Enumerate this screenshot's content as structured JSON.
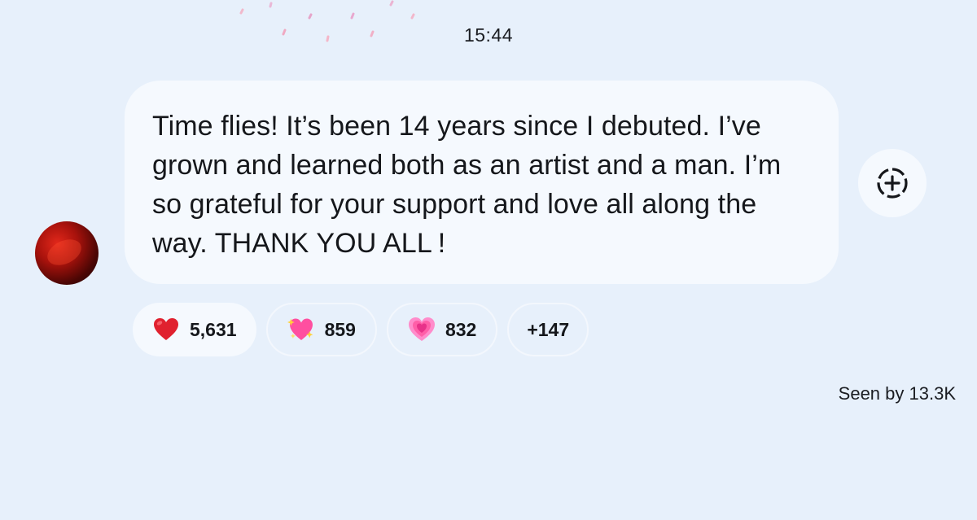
{
  "header": {
    "timestamp": "15:44"
  },
  "message": {
    "text": "Time flies! It’s been 14 years since I debuted. I’ve grown and learned both as an artist and a man. I’m so grateful for your support and love all along the way. THANK YOU ALL !"
  },
  "add_reaction": {
    "icon": "add-reaction-icon"
  },
  "reactions": [
    {
      "icon": "red-heart-icon",
      "count": "5,631",
      "selected": true
    },
    {
      "icon": "heart-with-ribbon-sparkles-icon",
      "count": "859",
      "selected": false
    },
    {
      "icon": "growing-heart-icon",
      "count": "832",
      "selected": false
    }
  ],
  "more_reactions": "+147",
  "seen_by": "Seen by 13.3K",
  "colors": {
    "background": "#e7f0fb",
    "bubble": "#f5f9fe",
    "heart_red": "#e0212f",
    "heart_pink": "#ff5fa8"
  }
}
